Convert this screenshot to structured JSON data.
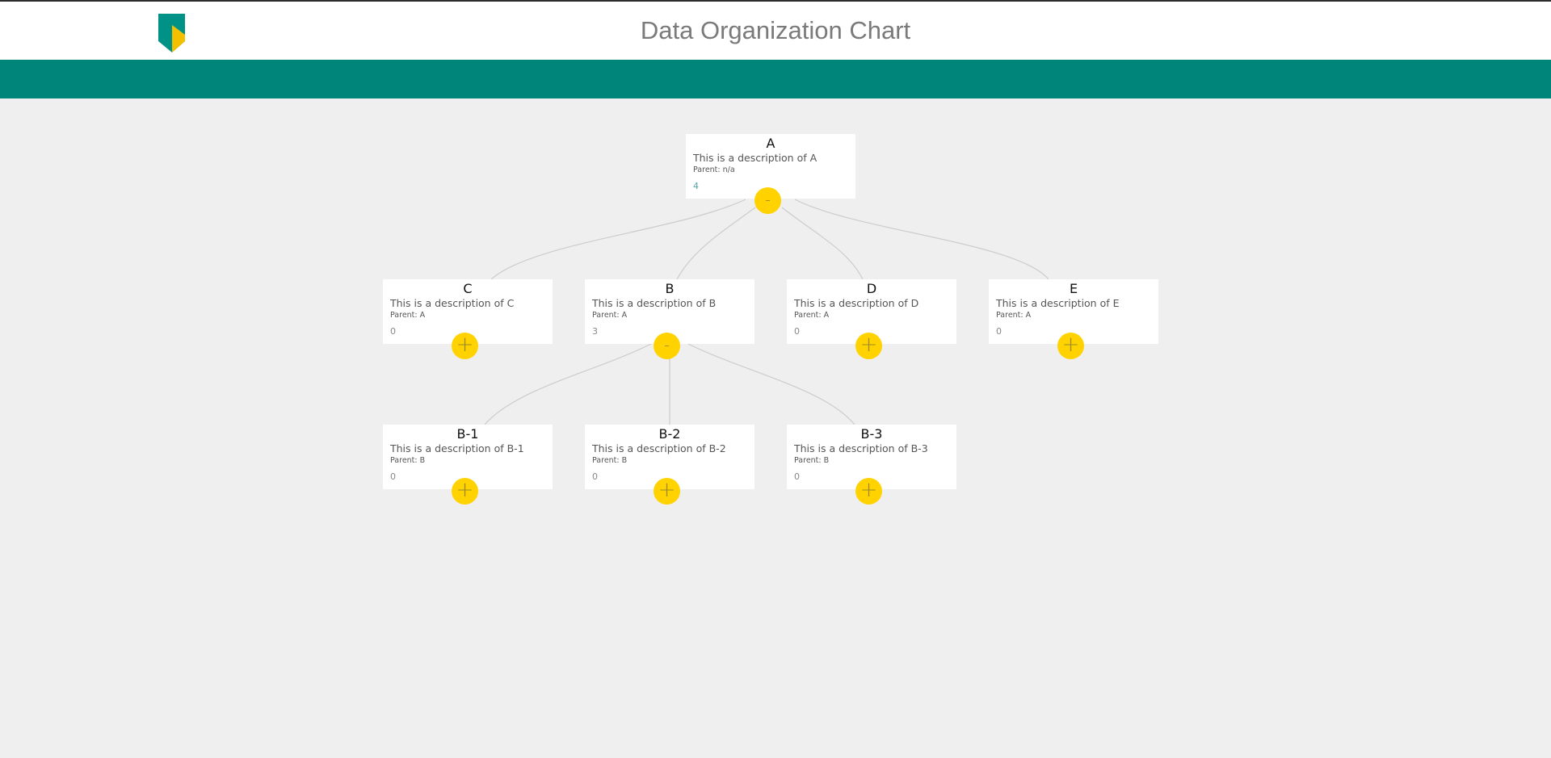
{
  "header": {
    "title": "Data Organization Chart",
    "logo_colors": {
      "green": "#009286",
      "yellow": "#f3c000"
    }
  },
  "colors": {
    "teal_bar": "#00857a",
    "background": "#efefef",
    "toggle": "#ffd200",
    "connector": "#cccccc"
  },
  "nodes": {
    "A": {
      "name": "A",
      "description": "This is a description of A",
      "parent": "Parent: n/a",
      "count": "4",
      "toggle": "-"
    },
    "C": {
      "name": "C",
      "description": "This is a description of C",
      "parent": "Parent: A",
      "count": "0",
      "toggle": "+"
    },
    "B": {
      "name": "B",
      "description": "This is a description of B",
      "parent": "Parent: A",
      "count": "3",
      "toggle": "-"
    },
    "D": {
      "name": "D",
      "description": "This is a description of D",
      "parent": "Parent: A",
      "count": "0",
      "toggle": "+"
    },
    "E": {
      "name": "E",
      "description": "This is a description of E",
      "parent": "Parent: A",
      "count": "0",
      "toggle": "+"
    },
    "B1": {
      "name": "B-1",
      "description": "This is a description of B-1",
      "parent": "Parent: B",
      "count": "0",
      "toggle": "+"
    },
    "B2": {
      "name": "B-2",
      "description": "This is a description of B-2",
      "parent": "Parent: B",
      "count": "0",
      "toggle": "+"
    },
    "B3": {
      "name": "B-3",
      "description": "This is a description of B-3",
      "parent": "Parent: B",
      "count": "0",
      "toggle": "+"
    }
  }
}
